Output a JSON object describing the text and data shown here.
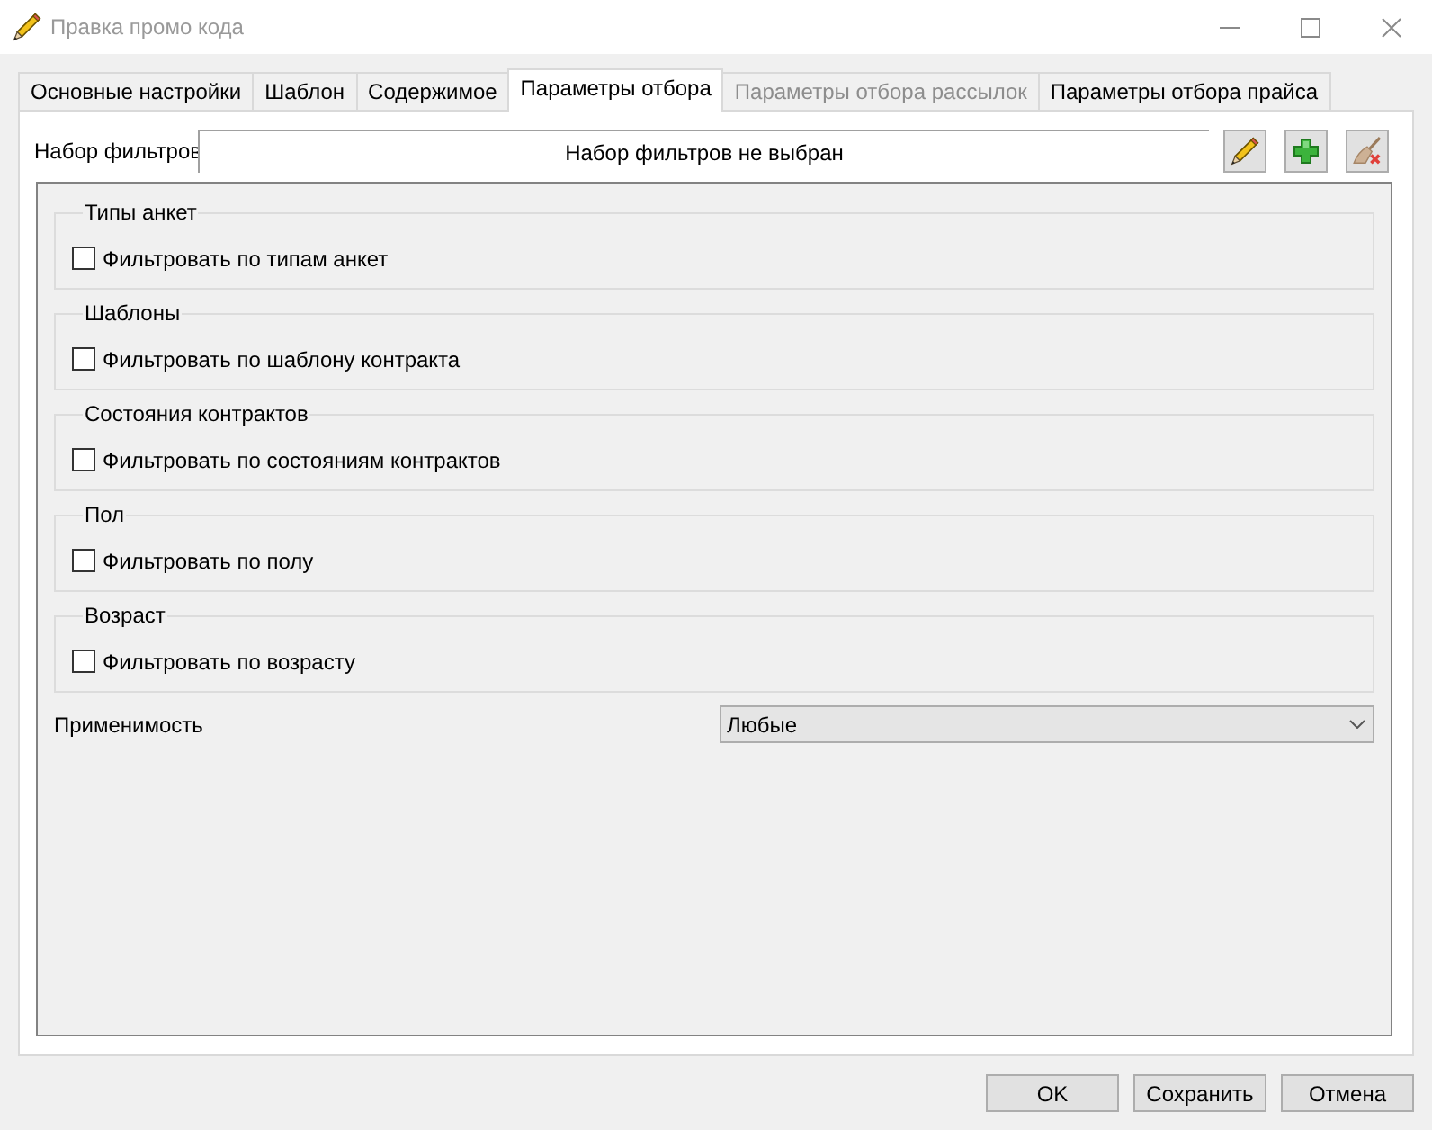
{
  "window": {
    "title": "Правка промо кода"
  },
  "tabs": [
    {
      "label": "Основные настройки",
      "selected": false,
      "disabled": false
    },
    {
      "label": "Шаблон",
      "selected": false,
      "disabled": false
    },
    {
      "label": "Содержимое",
      "selected": false,
      "disabled": false
    },
    {
      "label": "Параметры отбора",
      "selected": true,
      "disabled": false
    },
    {
      "label": "Параметры отбора рассылок",
      "selected": false,
      "disabled": true
    },
    {
      "label": "Параметры отбора прайса",
      "selected": false,
      "disabled": false
    }
  ],
  "filter_set": {
    "label": "Набор фильтров",
    "value": "Набор фильтров не выбран"
  },
  "filter_groups": [
    {
      "title": "Типы анкет",
      "checkbox_label": "Фильтровать по типам анкет",
      "checked": false
    },
    {
      "title": "Шаблоны",
      "checkbox_label": "Фильтровать по шаблону контракта",
      "checked": false
    },
    {
      "title": "Состояния контрактов",
      "checkbox_label": "Фильтровать по состояниям контрактов",
      "checked": false
    },
    {
      "title": "Пол",
      "checkbox_label": "Фильтровать по полу",
      "checked": false
    },
    {
      "title": "Возраст",
      "checkbox_label": "Фильтровать по возрасту",
      "checked": false
    }
  ],
  "applicability": {
    "label": "Применимость",
    "value": "Любые"
  },
  "buttons": [
    "OK",
    "Сохранить",
    "Отмена"
  ]
}
